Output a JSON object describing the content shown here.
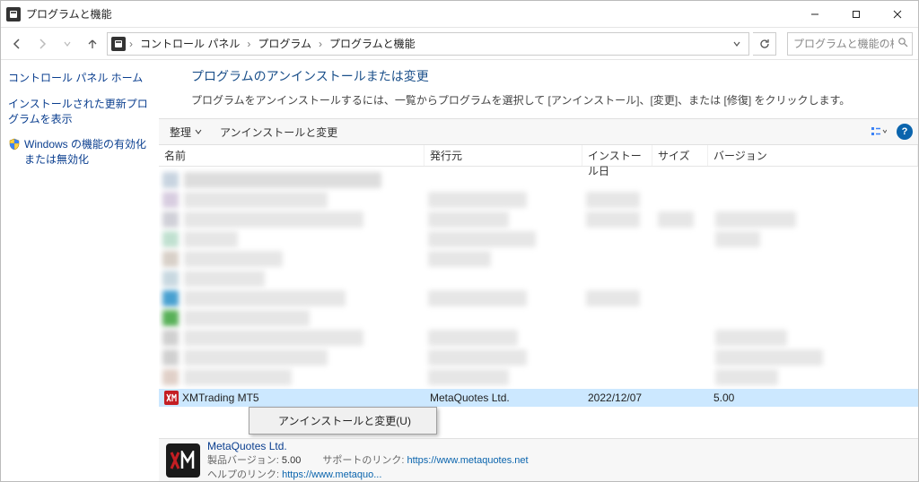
{
  "window_title": "プログラムと機能",
  "breadcrumb": [
    "コントロール パネル",
    "プログラム",
    "プログラムと機能"
  ],
  "search_placeholder": "プログラムと機能の検索",
  "sidebar": {
    "home": "コントロール パネル ホーム",
    "updates": "インストールされた更新プログラムを表示",
    "features": "Windows の機能の有効化または無効化"
  },
  "heading": {
    "title": "プログラムのアンインストールまたは変更",
    "desc": "プログラムをアンインストールするには、一覧からプログラムを選択して [アンインストール]、[変更]、または [修復] をクリックします。"
  },
  "toolbar": {
    "organize": "整理",
    "uninstall": "アンインストールと変更"
  },
  "columns": {
    "name": "名前",
    "publisher": "発行元",
    "date": "インストール日",
    "size": "サイズ",
    "version": "バージョン"
  },
  "selected_row": {
    "name": "XMTrading MT5",
    "publisher": "MetaQuotes Ltd.",
    "date": "2022/12/07",
    "size": "",
    "version": "5.00"
  },
  "context_menu": {
    "item": "アンインストールと変更(U)"
  },
  "details": {
    "publisher": "MetaQuotes Ltd.",
    "product_version_label": "製品バージョン:",
    "product_version": "5.00",
    "help_link_label": "ヘルプのリンク:",
    "help_link": "https://www.metaquo...",
    "support_link_label": "サポートのリンク:",
    "support_link": "https://www.metaquotes.net"
  }
}
